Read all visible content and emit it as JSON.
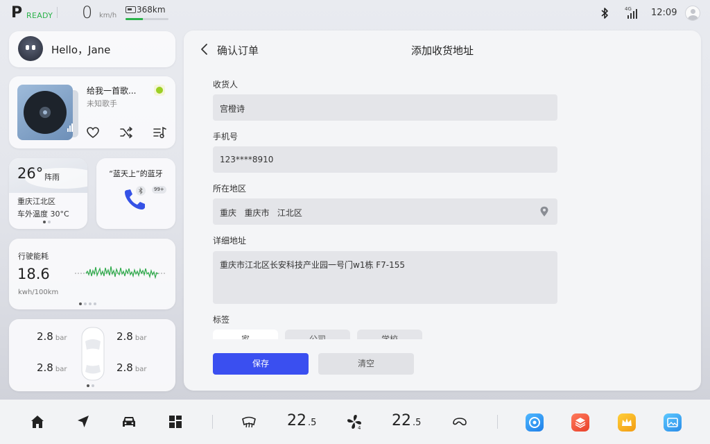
{
  "status_bar": {
    "gear": "P",
    "ready": "READY",
    "speed": "0",
    "speed_unit": "km/h",
    "range": "368km",
    "range_fraction": 0.4,
    "network": "4G",
    "time": "12:09"
  },
  "hello_card": {
    "greeting": "Hello，Jane"
  },
  "music_card": {
    "title": "给我一首歌...",
    "artist": "未知歌手",
    "controls": [
      "heart-icon",
      "shuffle-icon",
      "playlist-icon"
    ]
  },
  "weather_card": {
    "temperature": "26°",
    "condition": "阵雨",
    "city": "重庆江北区",
    "outside_temp": "车外温度 30°C",
    "page": 1,
    "pages": 2
  },
  "bluetooth_card": {
    "device_name": "“蓝天上”的蓝牙",
    "unread": "99+"
  },
  "energy_card": {
    "title": "行驶能耗",
    "value": "18.6",
    "unit": "kwh/100km",
    "page": 1,
    "pages": 4
  },
  "tire_card": {
    "front_left": "2.8",
    "front_right": "2.8",
    "rear_left": "2.8",
    "rear_right": "2.8",
    "unit": "bar",
    "page": 1,
    "pages": 2
  },
  "address_form": {
    "back_label": "确认订单",
    "title": "添加收货地址",
    "recipient_label": "收货人",
    "recipient_value": "宫橙诗",
    "phone_label": "手机号",
    "phone_value": "123****8910",
    "region_label": "所在地区",
    "region_value": "重庆   重庆市   江北区",
    "detail_label": "详细地址",
    "detail_value": "重庆市江北区长安科技产业园一号门w1栋 F7-155",
    "tag_label": "标签",
    "tags": [
      "家",
      "公司",
      "学校"
    ],
    "save_label": "保存",
    "clear_label": "清空"
  },
  "dock": {
    "left_temp_int": "22",
    "left_temp_dec": ".5",
    "fan_level": "4",
    "right_temp_int": "22",
    "right_temp_dec": ".5"
  },
  "colors": {
    "accent_blue": "#3a4ff0",
    "ready_green": "#2ab24a",
    "chart_green": "#2eaa4a"
  }
}
